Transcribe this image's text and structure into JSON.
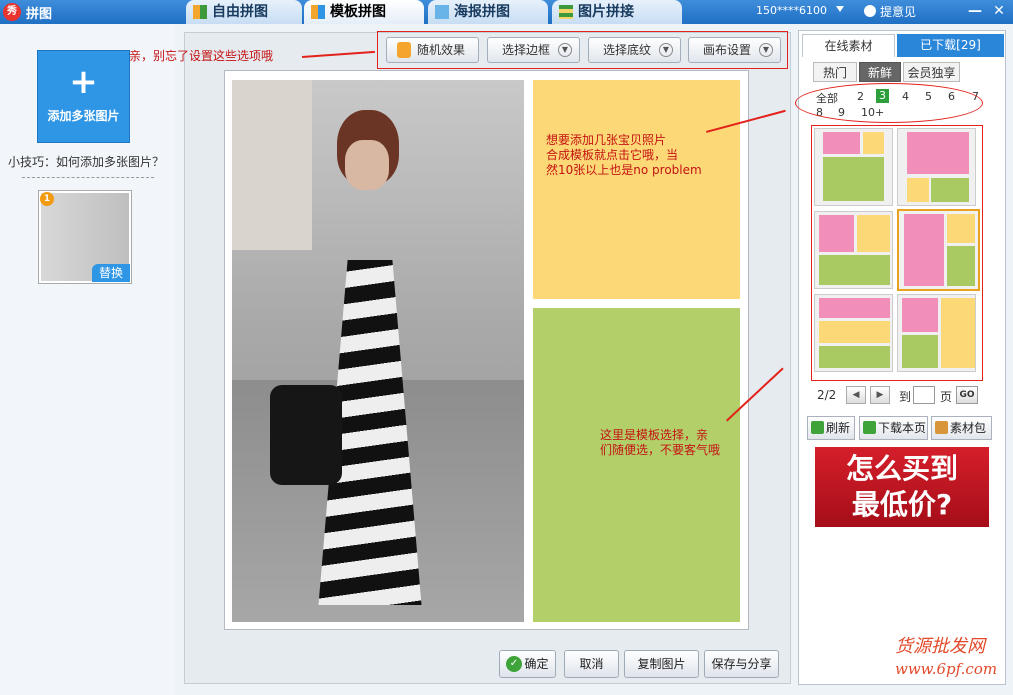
{
  "app": {
    "title": "拼图",
    "logo": "秀"
  },
  "tabs": [
    {
      "label": "自由拼图",
      "icon": "free-collage-icon"
    },
    {
      "label": "模板拼图",
      "icon": "template-collage-icon",
      "active": true
    },
    {
      "label": "海报拼图",
      "icon": "poster-collage-icon"
    },
    {
      "label": "图片拼接",
      "icon": "stitch-icon"
    }
  ],
  "header": {
    "user": "150****6100",
    "feedback": "提意见"
  },
  "left": {
    "add_label": "添加多张图片",
    "add_symbol": "+",
    "tip": "小技巧：如何添加多张图片？",
    "thumb_badge": "1",
    "replace_label": "替换"
  },
  "toolbar": {
    "random": "随机效果",
    "border": "选择边框",
    "texture": "选择底纹",
    "canvas": "画布设置"
  },
  "annotations": {
    "settings_note": "亲，别忘了设置这些选项哦",
    "count_note_1": "想要添加几张宝贝照片",
    "count_note_2": "合成模板就点击它哦，当",
    "count_note_3": "然10张以上也是no problem",
    "template_note_1": "这里是模板选择，亲",
    "template_note_2": "们随便选，不要客气哦"
  },
  "bottom": {
    "confirm": "确定",
    "cancel": "取消",
    "copy": "复制图片",
    "save_share": "保存与分享"
  },
  "right": {
    "tab_online": "在线素材",
    "tab_downloaded": "已下载[29]",
    "subtabs": [
      "热门",
      "新鲜",
      "会员独享"
    ],
    "counts": [
      "全部",
      "2",
      "3",
      "4",
      "5",
      "6",
      "7",
      "8",
      "9",
      "10+"
    ],
    "current_count": "3",
    "page": "2/2",
    "go_to": "到",
    "page_unit": "页",
    "go": "GO",
    "refresh": "刷新",
    "download_page": "下载本页",
    "material_pack": "素材包",
    "ad_line1": "怎么买到",
    "ad_line2": "最低价?"
  },
  "watermark": {
    "line1": "货源批发网",
    "line2": "www.6pf.com"
  },
  "colors": {
    "pink": "#f28fb8",
    "yellow": "#fcd876",
    "green": "#a9c963",
    "accent": "#2a86d8",
    "annotation": "#e2221b"
  }
}
